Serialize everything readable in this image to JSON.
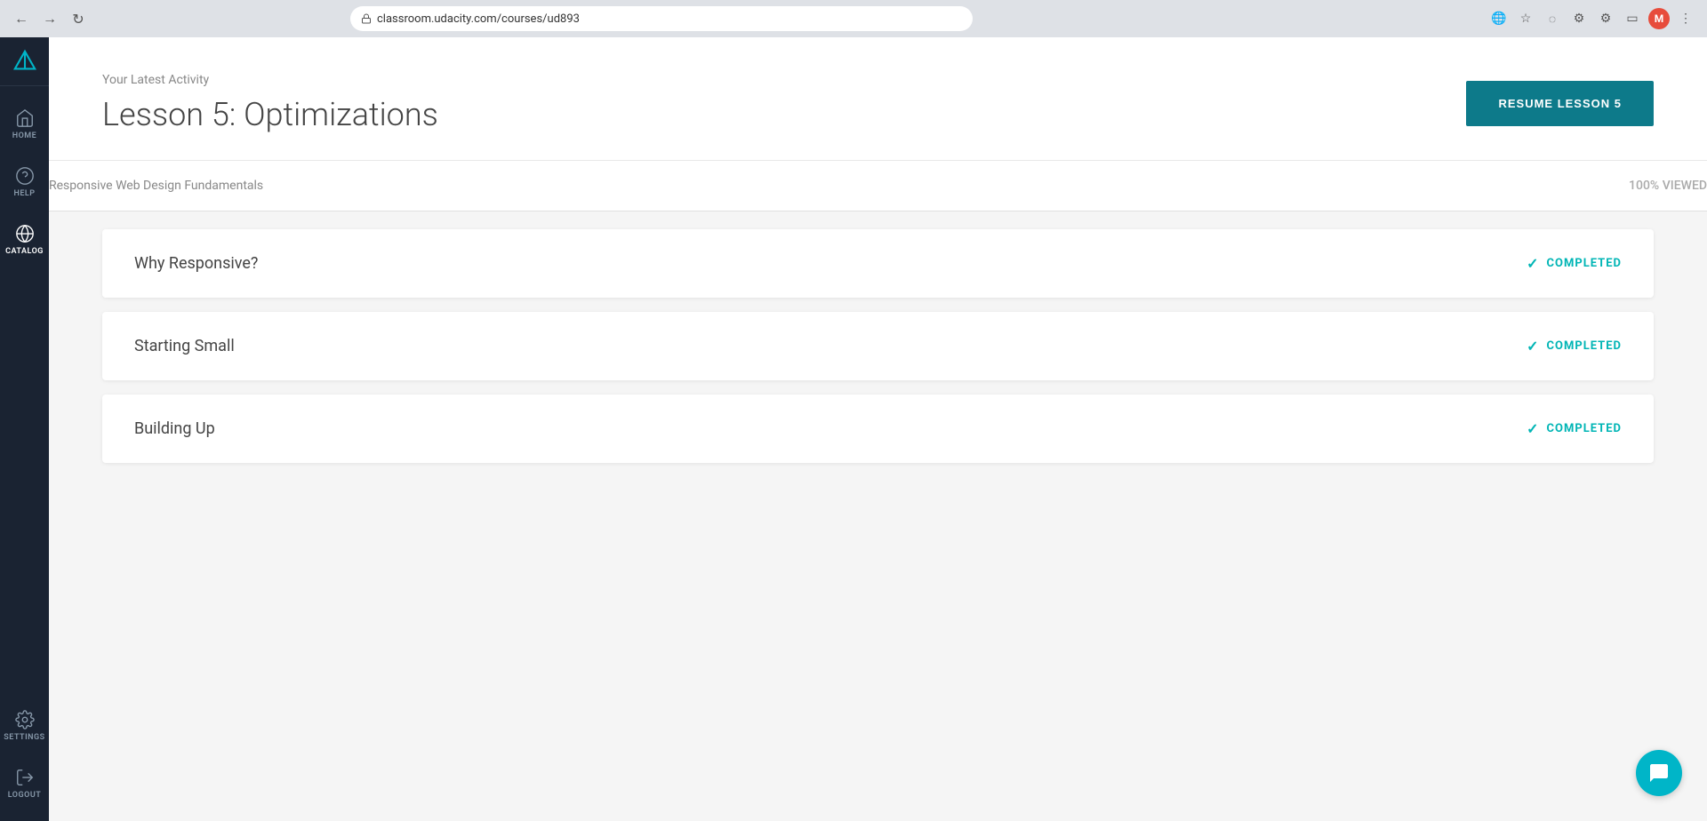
{
  "browser": {
    "url": "classroom.udacity.com/courses/ud893",
    "nav": {
      "back": "←",
      "forward": "→",
      "refresh": "↻"
    },
    "avatar_initial": "M"
  },
  "sidebar": {
    "logo_alt": "Udacity",
    "items": [
      {
        "id": "home",
        "label": "HOME",
        "icon": "home"
      },
      {
        "id": "help",
        "label": "HELP",
        "icon": "help"
      },
      {
        "id": "catalog",
        "label": "CATALOG",
        "icon": "catalog",
        "active": true
      }
    ],
    "bottom_items": [
      {
        "id": "settings",
        "label": "SETTINGS",
        "icon": "settings"
      },
      {
        "id": "logout",
        "label": "LOGOUT",
        "icon": "logout"
      }
    ]
  },
  "activity": {
    "label": "Your Latest Activity",
    "title": "Lesson 5: Optimizations",
    "resume_button": "RESUME LESSON 5"
  },
  "course": {
    "name": "Responsive Web Design Fundamentals",
    "viewed_percent": "100% VIEWED"
  },
  "lessons": [
    {
      "id": 1,
      "title": "Why Responsive?",
      "status": "COMPLETED"
    },
    {
      "id": 2,
      "title": "Starting Small",
      "status": "COMPLETED"
    },
    {
      "id": 3,
      "title": "Building Up",
      "status": "COMPLETED"
    }
  ],
  "colors": {
    "sidebar_bg": "#1a2332",
    "teal": "#0d7a8a",
    "completed_color": "#00b5b5",
    "chat_bg": "#00b5c8"
  }
}
